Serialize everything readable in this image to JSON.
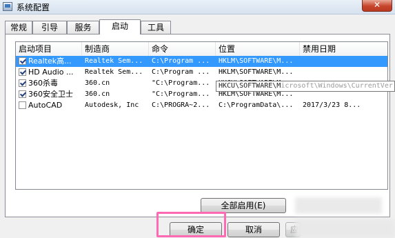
{
  "window": {
    "title": "系统配置",
    "close_symbol": "✕"
  },
  "tabs": [
    "常规",
    "引导",
    "服务",
    "启动",
    "工具"
  ],
  "active_tab": "启动",
  "columns": [
    "启动项目",
    "制造商",
    "命令",
    "位置",
    "禁用日期"
  ],
  "rows": [
    {
      "checked": true,
      "selected": true,
      "item": "Realtek高...",
      "maker": "Realtek Sem...",
      "command": "C:\\Program ...",
      "location": "HKLM\\SOFTWARE\\M...",
      "disabled_date": ""
    },
    {
      "checked": true,
      "selected": false,
      "item": "HD Audio ...",
      "maker": "Realtek Sem...",
      "command": "C:\\Program ...",
      "location": "HKLM\\SOFTWARE\\M...",
      "disabled_date": ""
    },
    {
      "checked": true,
      "selected": false,
      "item": "360杀毒",
      "maker": "360.cn",
      "command": "\"C:\\Program...",
      "location": "HKCU\\SOFTWARE\\M...",
      "disabled_date": ""
    },
    {
      "checked": true,
      "selected": false,
      "item": "360安全卫士",
      "maker": "360.cn",
      "command": "\"C:\\Program...",
      "location": "HKLM\\SOFTWARE\\M...",
      "disabled_date": ""
    },
    {
      "checked": false,
      "selected": false,
      "item": "AutoCAD",
      "maker": "Autodesk, Inc",
      "command": "C:\\PROGRA~2...",
      "location": "C:\\ProgramData\\...",
      "disabled_date": "2017/3/23 8..."
    }
  ],
  "tooltip": {
    "prefix": "HKCU\\SOFTWARE\\M",
    "rest": "icrosoft\\Windows\\CurrentVer"
  },
  "buttons": {
    "enable_all": "全部启用(E)",
    "ok": "确定",
    "cancel": "取消",
    "apply_partial": "应"
  }
}
